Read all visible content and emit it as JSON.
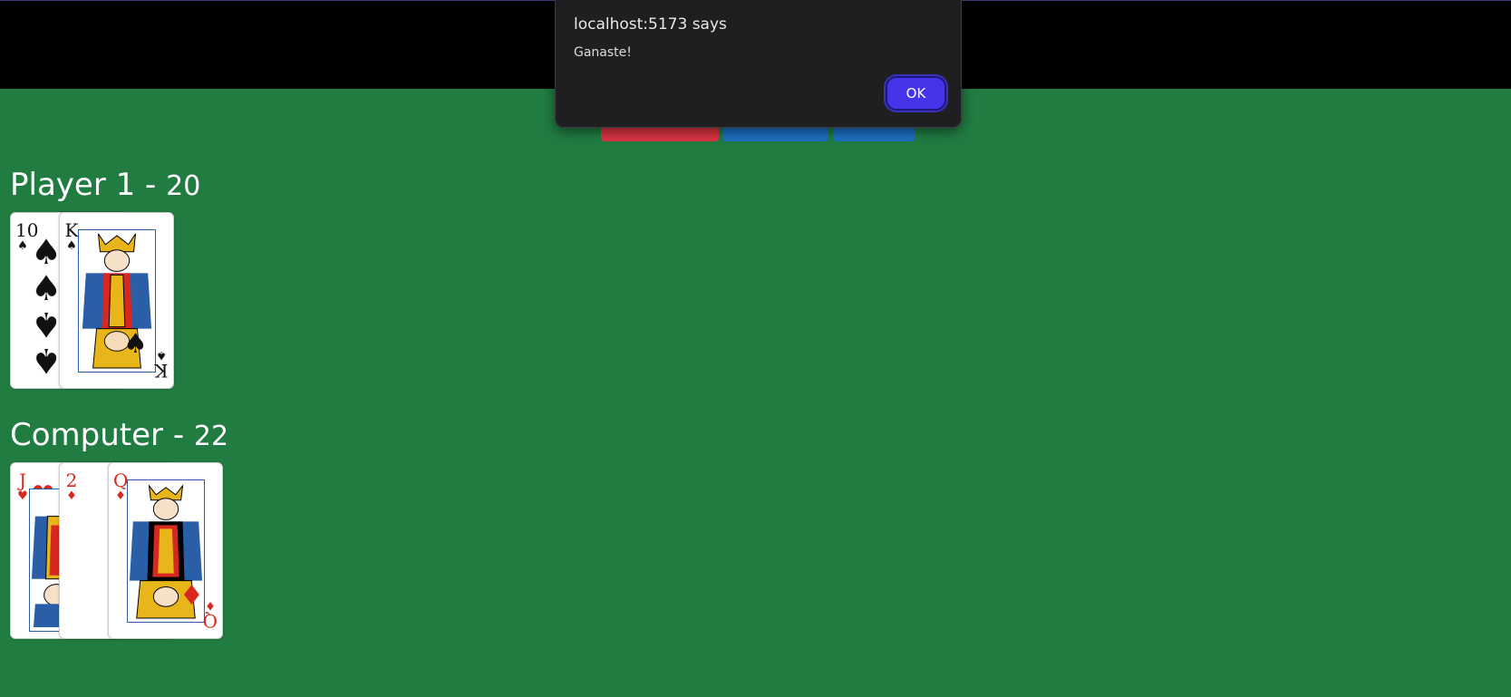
{
  "dialog": {
    "title": "localhost:5173 says",
    "message": "Ganaste!",
    "ok_label": "OK"
  },
  "controls": {
    "buttons": [
      {
        "label": "",
        "color": "#dc3545"
      },
      {
        "label": "",
        "color": "#1c6fc4"
      },
      {
        "label": "",
        "color": "#1c6fc4"
      }
    ]
  },
  "player": {
    "name": "Player 1",
    "separator": " - ",
    "score": "20",
    "cards": [
      {
        "rank": "10",
        "suit": "♠",
        "color": "black"
      },
      {
        "rank": "K",
        "suit": "♠",
        "color": "black"
      }
    ]
  },
  "computer": {
    "name": "Computer",
    "separator": " - ",
    "score": "22",
    "cards": [
      {
        "rank": "J",
        "suit": "♥",
        "color": "red"
      },
      {
        "rank": "2",
        "suit": "♦",
        "color": "red"
      },
      {
        "rank": "Q",
        "suit": "♦",
        "color": "red"
      }
    ]
  },
  "colors": {
    "table": "#217c42",
    "header": "#000000",
    "dialog_bg": "#1f1f22",
    "ok_button": "#4535ea",
    "card_red": "#d6281e"
  }
}
